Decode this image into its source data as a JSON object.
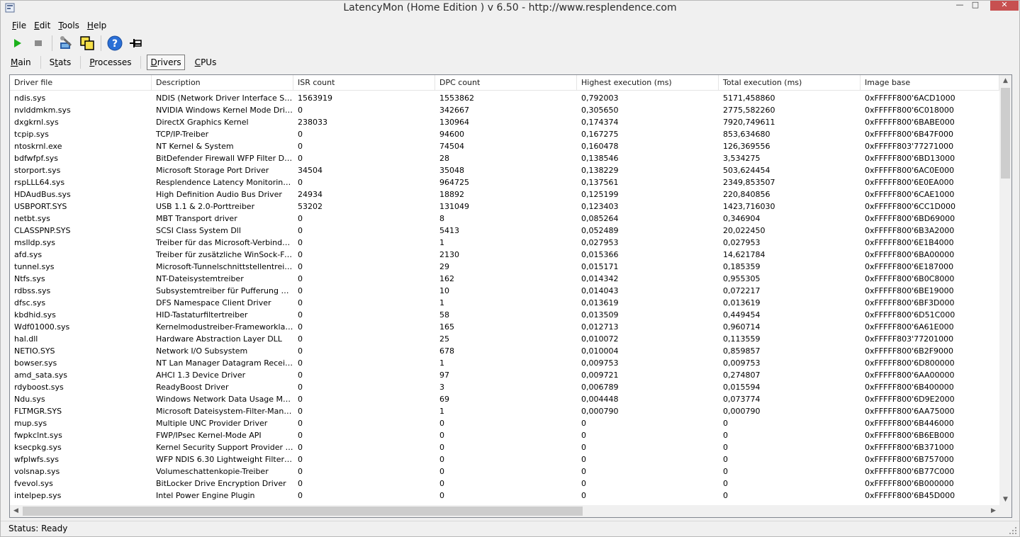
{
  "window": {
    "title": "LatencyMon  (Home Edition )  v 6.50 - http://www.resplendence.com",
    "minimize_glyph": "—",
    "maximize_glyph": "□",
    "close_glyph": "✕"
  },
  "menu": {
    "file": {
      "accel": "F",
      "rest": "ile"
    },
    "edit": {
      "accel": "E",
      "rest": "dit"
    },
    "tools": {
      "accel": "T",
      "rest": "ools"
    },
    "help": {
      "accel": "H",
      "rest": "elp"
    }
  },
  "toolbar": {
    "icons": [
      "play-icon",
      "stop-icon",
      "settings-wrench-icon",
      "copy-windows-icon",
      "help-icon",
      "pin-icon"
    ],
    "colors": {
      "play": "#1bb11b",
      "stop": "#8c8c8c",
      "help": "#2a6fd6"
    }
  },
  "tabs": {
    "main": {
      "accel": "M",
      "rest": "ain"
    },
    "stats": {
      "pre": "S",
      "accel": "t",
      "rest": "ats"
    },
    "processes": {
      "accel": "P",
      "rest": "rocesses"
    },
    "drivers": {
      "accel": "D",
      "rest": "rivers"
    },
    "cpus": {
      "accel": "C",
      "rest": "PUs"
    }
  },
  "table": {
    "columns": [
      "Driver file",
      "Description",
      "ISR count",
      "DPC count",
      "Highest execution (ms)",
      "Total execution (ms)",
      "Image base"
    ],
    "rows": [
      [
        "ndis.sys",
        "NDIS (Network Driver Interface Spe...",
        "1563919",
        "1553862",
        "0,792003",
        "5171,458860",
        "0xFFFFF800'6ACD1000"
      ],
      [
        "nvlddmkm.sys",
        "NVIDIA Windows Kernel Mode Drive...",
        "0",
        "342667",
        "0,305650",
        "2775,582260",
        "0xFFFFF800'6C018000"
      ],
      [
        "dxgkrnl.sys",
        "DirectX Graphics Kernel",
        "238033",
        "130964",
        "0,174374",
        "7920,749611",
        "0xFFFFF800'6BABE000"
      ],
      [
        "tcpip.sys",
        "TCP/IP-Treiber",
        "0",
        "94600",
        "0,167275",
        "853,634680",
        "0xFFFFF800'6B47F000"
      ],
      [
        "ntoskrnl.exe",
        "NT Kernel & System",
        "0",
        "74504",
        "0,160478",
        "126,369556",
        "0xFFFFF803'77271000"
      ],
      [
        "bdfwfpf.sys",
        "BitDefender Firewall WFP Filter Driver",
        "0",
        "28",
        "0,138546",
        "3,534275",
        "0xFFFFF800'6BD13000"
      ],
      [
        "storport.sys",
        "Microsoft Storage Port Driver",
        "34504",
        "35048",
        "0,138229",
        "503,624454",
        "0xFFFFF800'6AC0E000"
      ],
      [
        "rspLLL64.sys",
        "Resplendence Latency Monitoring a...",
        "0",
        "964725",
        "0,137561",
        "2349,853507",
        "0xFFFFF800'6E0EA000"
      ],
      [
        "HDAudBus.sys",
        "High Definition Audio Bus Driver",
        "24934",
        "18892",
        "0,125199",
        "220,840856",
        "0xFFFFF800'6CAE1000"
      ],
      [
        "USBPORT.SYS",
        "USB 1.1 & 2.0-Porttreiber",
        "53202",
        "131049",
        "0,123403",
        "1423,716030",
        "0xFFFFF800'6CC1D000"
      ],
      [
        "netbt.sys",
        "MBT Transport driver",
        "0",
        "8",
        "0,085264",
        "0,346904",
        "0xFFFFF800'6BD69000"
      ],
      [
        "CLASSPNP.SYS",
        "SCSI Class System Dll",
        "0",
        "5413",
        "0,052489",
        "20,022450",
        "0xFFFFF800'6B3A2000"
      ],
      [
        "mslldp.sys",
        "Treiber für das Microsoft-Verbindun...",
        "0",
        "1",
        "0,027953",
        "0,027953",
        "0xFFFFF800'6E1B4000"
      ],
      [
        "afd.sys",
        "Treiber für zusätzliche WinSock-Fun...",
        "0",
        "2130",
        "0,015366",
        "14,621784",
        "0xFFFFF800'6BA00000"
      ],
      [
        "tunnel.sys",
        "Microsoft-Tunnelschnittstellentreiber",
        "0",
        "29",
        "0,015171",
        "0,185359",
        "0xFFFFF800'6E187000"
      ],
      [
        "Ntfs.sys",
        "NT-Dateisystemtreiber",
        "0",
        "162",
        "0,014342",
        "0,955305",
        "0xFFFFF800'6B0C8000"
      ],
      [
        "rdbss.sys",
        "Subsystemtreiber für Pufferung des...",
        "0",
        "10",
        "0,014043",
        "0,072217",
        "0xFFFFF800'6BE19000"
      ],
      [
        "dfsc.sys",
        "DFS Namespace Client Driver",
        "0",
        "1",
        "0,013619",
        "0,013619",
        "0xFFFFF800'6BF3D000"
      ],
      [
        "kbdhid.sys",
        "HID-Tastaturfiltertreiber",
        "0",
        "58",
        "0,013509",
        "0,449454",
        "0xFFFFF800'6D51C000"
      ],
      [
        "Wdf01000.sys",
        "Kernelmodustreiber-Frameworklaufzeit",
        "0",
        "165",
        "0,012713",
        "0,960714",
        "0xFFFFF800'6A61E000"
      ],
      [
        "hal.dll",
        "Hardware Abstraction Layer DLL",
        "0",
        "25",
        "0,010072",
        "0,113559",
        "0xFFFFF803'77201000"
      ],
      [
        "NETIO.SYS",
        "Network I/O Subsystem",
        "0",
        "678",
        "0,010004",
        "0,859857",
        "0xFFFFF800'6B2F9000"
      ],
      [
        "bowser.sys",
        "NT Lan Manager Datagram Receiver...",
        "0",
        "1",
        "0,009753",
        "0,009753",
        "0xFFFFF800'6D800000"
      ],
      [
        "amd_sata.sys",
        "AHCI 1.3 Device Driver",
        "0",
        "97",
        "0,009721",
        "0,274807",
        "0xFFFFF800'6AA00000"
      ],
      [
        "rdyboost.sys",
        "ReadyBoost Driver",
        "0",
        "3",
        "0,006789",
        "0,015594",
        "0xFFFFF800'6B400000"
      ],
      [
        "Ndu.sys",
        "Windows Network Data Usage Monit...",
        "0",
        "69",
        "0,004448",
        "0,073774",
        "0xFFFFF800'6D9E2000"
      ],
      [
        "FLTMGR.SYS",
        "Microsoft Dateisystem-Filter-Manager",
        "0",
        "1",
        "0,000790",
        "0,000790",
        "0xFFFFF800'6AA75000"
      ],
      [
        "mup.sys",
        "Multiple UNC Provider Driver",
        "0",
        "0",
        "0",
        "0",
        "0xFFFFF800'6B446000"
      ],
      [
        "fwpkclnt.sys",
        "FWP/IPsec Kernel-Mode API",
        "0",
        "0",
        "0",
        "0",
        "0xFFFFF800'6B6EB000"
      ],
      [
        "ksecpkg.sys",
        "Kernel Security Support Provider Int...",
        "0",
        "0",
        "0",
        "0",
        "0xFFFFF800'6B371000"
      ],
      [
        "wfplwfs.sys",
        "WFP NDIS 6.30 Lightweight Filter Dr...",
        "0",
        "0",
        "0",
        "0",
        "0xFFFFF800'6B757000"
      ],
      [
        "volsnap.sys",
        "Volumeschattenkopie-Treiber",
        "0",
        "0",
        "0",
        "0",
        "0xFFFFF800'6B77C000"
      ],
      [
        "fvevol.sys",
        "BitLocker Drive Encryption Driver",
        "0",
        "0",
        "0",
        "0",
        "0xFFFFF800'6B000000"
      ],
      [
        "intelpep.sys",
        "Intel Power Engine Plugin",
        "0",
        "0",
        "0",
        "0",
        "0xFFFFF800'6B45D000"
      ]
    ]
  },
  "scrollbars": {
    "up": "▲",
    "down": "▼",
    "left": "◀",
    "right": "▶"
  },
  "status": {
    "text": "Status: Ready"
  }
}
